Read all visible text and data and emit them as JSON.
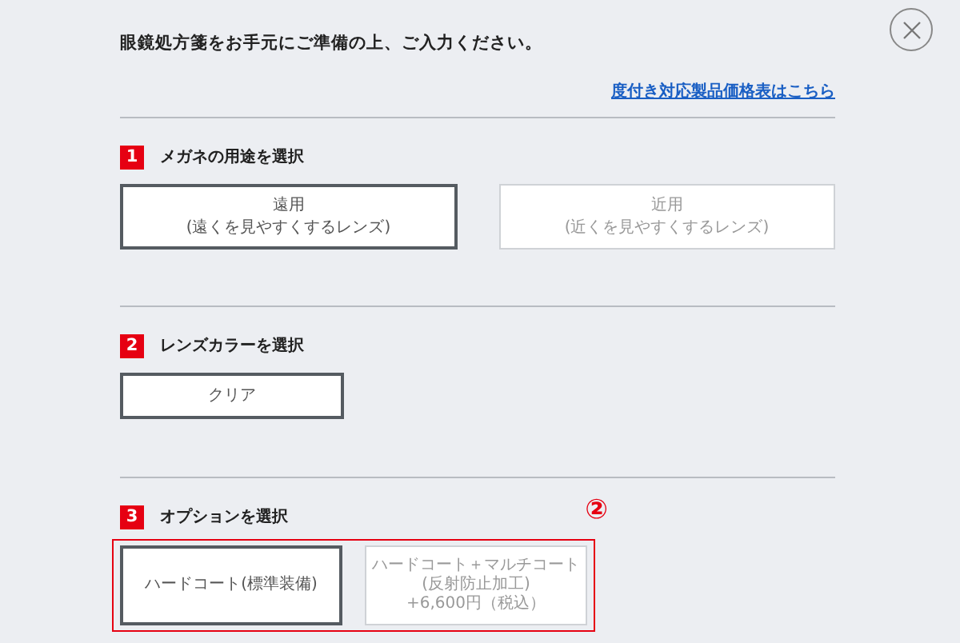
{
  "instruction": "眼鏡処方箋をお手元にご準備の上、ご入力ください。",
  "price_link": "度付き対応製品価格表はこちら",
  "sections": [
    {
      "number": "1",
      "title": "メガネの用途を選択",
      "kind": "wide",
      "options": [
        {
          "lines": [
            "遠用",
            "(遠くを見やすくするレンズ)"
          ],
          "selected": true
        },
        {
          "lines": [
            "近用",
            "(近くを見やすくするレンズ)"
          ],
          "selected": false
        }
      ]
    },
    {
      "number": "2",
      "title": "レンズカラーを選択",
      "kind": "compact",
      "options": [
        {
          "lines": [
            "クリア"
          ],
          "selected": true
        }
      ]
    },
    {
      "number": "3",
      "title": "オプションを選択",
      "kind": "compact",
      "highlight": {
        "label": "②"
      },
      "options": [
        {
          "lines": [
            "ハードコート(標準装備)"
          ],
          "selected": true
        },
        {
          "lines": [
            "ハードコート＋マルチコート(反射防止加工)",
            "+6,600円（税込）"
          ],
          "selected": false
        }
      ]
    }
  ]
}
